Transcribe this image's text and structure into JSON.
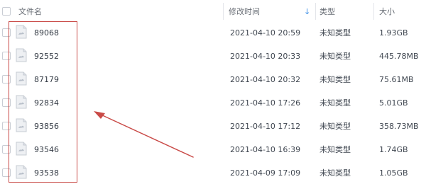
{
  "header": {
    "name": "文件名",
    "mtime": "修改时间",
    "type": "类型",
    "size": "大小",
    "sort_icon": "arrow-down-icon"
  },
  "rows": [
    {
      "name": "89068",
      "mtime": "2021-04-10 20:59",
      "type": "未知类型",
      "size": "1.93GB"
    },
    {
      "name": "92552",
      "mtime": "2021-04-10 20:33",
      "type": "未知类型",
      "size": "445.78MB"
    },
    {
      "name": "87179",
      "mtime": "2021-04-10 20:32",
      "type": "未知类型",
      "size": "75.61MB"
    },
    {
      "name": "92834",
      "mtime": "2021-04-10 17:26",
      "type": "未知类型",
      "size": "5.01GB"
    },
    {
      "name": "93856",
      "mtime": "2021-04-10 17:12",
      "type": "未知类型",
      "size": "358.73MB"
    },
    {
      "name": "93546",
      "mtime": "2021-04-10 16:39",
      "type": "未知类型",
      "size": "1.74GB"
    },
    {
      "name": "93538",
      "mtime": "2021-04-09 17:09",
      "type": "未知类型",
      "size": "1.05GB"
    }
  ],
  "colors": {
    "annotation": "#c94a47",
    "sort_accent": "#3a8ee6"
  },
  "icons": {
    "file": "generic-file-icon"
  }
}
